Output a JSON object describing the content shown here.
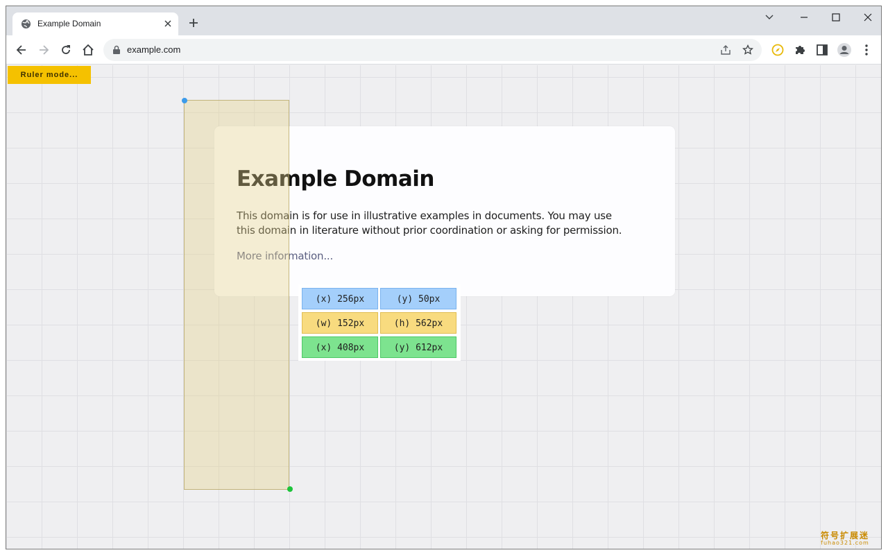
{
  "browser": {
    "tab_title": "Example Domain",
    "url": "example.com"
  },
  "page": {
    "ruler_button_label": "Ruler mode...",
    "heading": "Example Domain",
    "body_text": "This domain is for use in illustrative examples in documents. You may use this domain in literature without prior coordination or asking for permission.",
    "link_text": "More information..."
  },
  "measurement": {
    "start_x": "(x) 256px",
    "start_y": "(y) 50px",
    "width": "(w) 152px",
    "height": "(h) 562px",
    "end_x": "(x) 408px",
    "end_y": "(y) 612px"
  },
  "watermark": {
    "chinese": "符号扩展迷",
    "domain": "fuhao321.com"
  },
  "colors": {
    "ruler_button": "#f5c100",
    "start_point": "#3c9bea",
    "end_point": "#1dc43a"
  },
  "icons": [
    "globe-icon",
    "close-icon",
    "plus-icon",
    "chevron-down-icon",
    "minimize-icon",
    "maximize-icon",
    "back-icon",
    "forward-icon",
    "reload-icon",
    "home-icon",
    "lock-icon",
    "share-icon",
    "star-icon",
    "ruler-extension-icon",
    "puzzle-icon",
    "side-panel-icon",
    "profile-icon",
    "kebab-menu-icon"
  ]
}
